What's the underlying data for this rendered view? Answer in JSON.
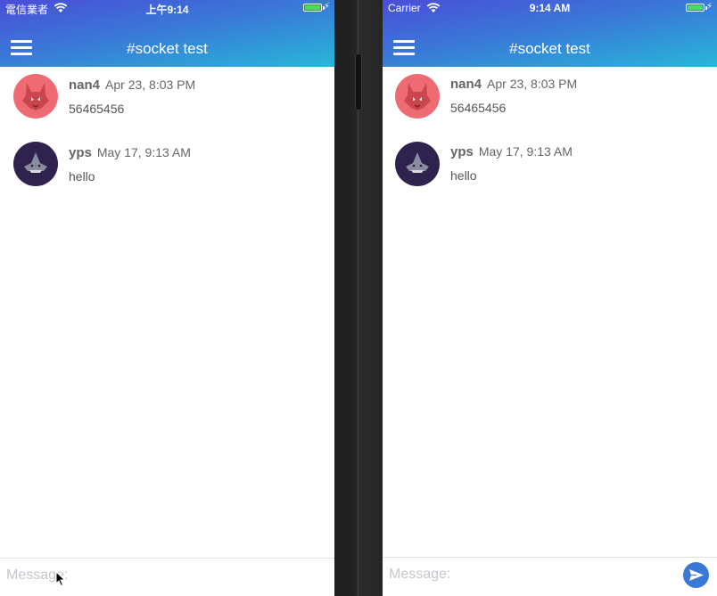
{
  "left_phone": {
    "carrier": "電信業者",
    "time": "上午9:14",
    "title": "#socket test",
    "messages": [
      {
        "user": "nan4",
        "time": "Apr 23, 8:03 PM",
        "text": "56465456",
        "avatar_color": "#ee6b73"
      },
      {
        "user": "yps",
        "time": "May 17, 9:13 AM",
        "text": "hello",
        "avatar_color": "#30224f"
      }
    ],
    "composer_placeholder": "Message:"
  },
  "right_phone": {
    "carrier": "Carrier",
    "time": "9:14 AM",
    "title": "#socket test",
    "messages": [
      {
        "user": "nan4",
        "time": "Apr 23, 8:03 PM",
        "text": "56465456",
        "avatar_color": "#ee6b73"
      },
      {
        "user": "yps",
        "time": "May 17, 9:13 AM",
        "text": "hello",
        "avatar_color": "#30224f"
      }
    ],
    "composer_placeholder": "Message:"
  },
  "icons": {
    "menu": "menu-icon",
    "wifi": "wifi-icon",
    "battery": "battery-icon",
    "send": "send-icon",
    "cursor": "cursor-icon",
    "wolf_avatar": "wolf-avatar-icon",
    "shark_avatar": "shark-avatar-icon"
  },
  "colors": {
    "header_gradient_start": "#4a4dd8",
    "header_gradient_end": "#27b7d8",
    "send_button": "#3a78d8",
    "battery_fill": "#4cd964"
  }
}
